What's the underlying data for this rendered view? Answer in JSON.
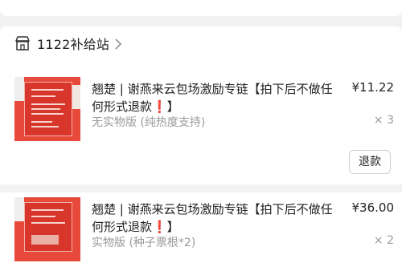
{
  "shop": {
    "name": "1122补给站"
  },
  "items": [
    {
      "title": "翘楚 | 谢燕来云包场激励专链【拍下后不做任何形式退款❗️】",
      "price": "¥11.22",
      "variant": "无实物版 (纯热度支持)",
      "qty": "× 3",
      "action": "退款"
    },
    {
      "title": "翘楚 | 谢燕来云包场激励专链【拍下后不做任何形式退款❗️】",
      "price": "¥36.00",
      "variant": "实物版 (种子票根*2)",
      "qty": "× 2"
    }
  ],
  "colors": {
    "accent_red": "#e74a3b",
    "muted_text": "#9a9a9a"
  }
}
